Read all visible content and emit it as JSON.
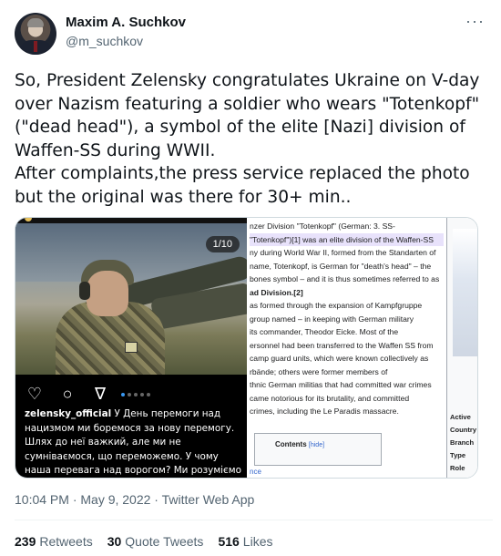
{
  "tweet": {
    "display_name": "Maxim A. Suchkov",
    "handle": "@m_suchkov",
    "more_icon": "ellipsis-icon",
    "text_paragraph_1": "So, President Zelensky congratulates Ukraine on V-day over Nazism featuring a soldier who wears \"Totenkopf\"(\"dead head\"), a symbol of the elite [Nazi] division of Waffen-SS during WWII.",
    "text_paragraph_2": "After complaints,the press service replaced the photo but the original was there for 30+ min..",
    "timestamp": "10:04 PM · May 9, 2022 · Twitter Web App"
  },
  "instagram": {
    "counter": "1/10",
    "icons": [
      "heart-icon",
      "comment-icon",
      "share-icon"
    ],
    "username": "zelensky_official",
    "caption": "У День перемоги над нацизмом ми боремося за нову перемогу. Шлях до неї важкий, але ми не сумніваємося, що переможемо. У чому наша перевага над ворогом? Ми розуміємо на одну книгу. Це підручник з історії України. Ми б не знали горя,"
  },
  "wikipedia": {
    "lines": [
      "nzer Division \"Totenkopf\" (German: 3. SS-",
      "\"Totenkopf\")[1] was an elite division of the Waffen-SS",
      "ny during World War II, formed from the Standarten of",
      "name, Totenkopf, is German for \"death's head\" – the",
      "bones symbol – and it is thus sometimes referred to as",
      "ad Division.[2]",
      "",
      "as formed through the expansion of Kampfgruppe",
      " group named – in keeping with German military",
      " its commander, Theodor Eicke. Most of the",
      "ersonnel had been transferred to the Waffen SS from",
      "camp guard units, which were known collectively as",
      "rbände; others were former members of",
      "thnic German militias that had committed war crimes",
      "",
      " came notorious for its brutality, and committed",
      " crimes, including the Le Paradis massacre."
    ],
    "toc_title": "Contents",
    "toc_hide": "[hide]",
    "bottom_link": "nce",
    "infobox_rows": [
      "Active",
      "Country",
      "Branch",
      "Type",
      "Role"
    ]
  },
  "stats": {
    "retweets_count": "239",
    "retweets_label": "Retweets",
    "quotes_count": "30",
    "quotes_label": "Quote Tweets",
    "likes_count": "516",
    "likes_label": "Likes"
  }
}
